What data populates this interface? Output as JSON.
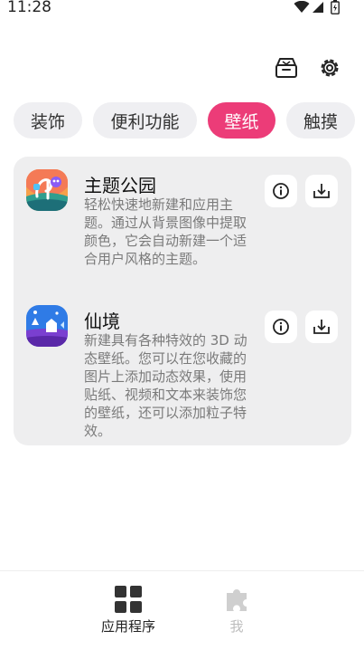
{
  "status_bar": {
    "time": "11:28"
  },
  "header": {
    "store_icon": "store-box-icon",
    "settings_icon": "gear-icon"
  },
  "categories": [
    {
      "label": "装饰",
      "active": false
    },
    {
      "label": "便利功能",
      "active": false
    },
    {
      "label": "壁纸",
      "active": true
    },
    {
      "label": "触摸",
      "active": false
    }
  ],
  "colors": {
    "accent": "#ec3c78",
    "card_bg": "#eeeeef",
    "chip_bg": "#efeff2"
  },
  "items": [
    {
      "title": "主题公园",
      "description": "轻松快速地新建和应用主题。通过从背景图像中提取颜色，它会自动新建一个适合用户风格的主题。",
      "icon": "theme-park-icon"
    },
    {
      "title": "仙境",
      "description": "新建具有各种特效的 3D 动态壁纸。您可以在您收藏的图片上添加动态效果，使用贴纸、视频和文本来装饰您的壁纸，还可以添加粒子特效。",
      "icon": "wonderland-icon"
    }
  ],
  "bottom_nav": [
    {
      "label": "应用程序",
      "icon": "grid-icon",
      "active": true
    },
    {
      "label": "我",
      "icon": "puzzle-icon",
      "active": false
    }
  ]
}
